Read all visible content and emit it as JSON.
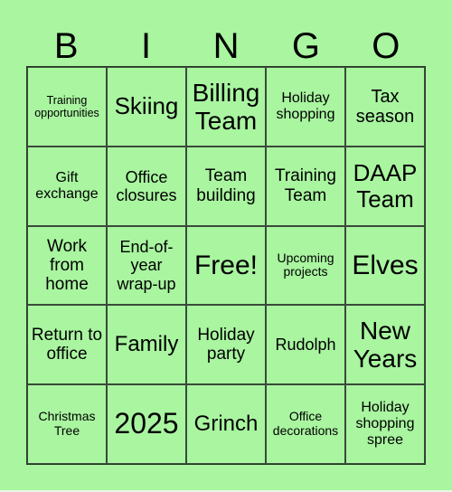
{
  "header": {
    "letters": [
      "B",
      "I",
      "N",
      "G",
      "O"
    ]
  },
  "cells": [
    {
      "text": "Training opportunities",
      "size": "s12"
    },
    {
      "text": "Skiing",
      "size": "s26"
    },
    {
      "text": "Billing Team",
      "size": "s28"
    },
    {
      "text": "Holiday shopping",
      "size": "s16"
    },
    {
      "text": "Tax season",
      "size": "s20"
    },
    {
      "text": "Gift exchange",
      "size": "s16"
    },
    {
      "text": "Office closures",
      "size": "s18"
    },
    {
      "text": "Team building",
      "size": "s19"
    },
    {
      "text": "Training Team",
      "size": "s19"
    },
    {
      "text": "DAAP Team",
      "size": "s26"
    },
    {
      "text": "Work from home",
      "size": "s19"
    },
    {
      "text": "End-of-year wrap-up",
      "size": "s18"
    },
    {
      "text": "Free!",
      "size": "s30"
    },
    {
      "text": "Upcoming projects",
      "size": "s14"
    },
    {
      "text": "Elves",
      "size": "s30"
    },
    {
      "text": "Return to office",
      "size": "s19"
    },
    {
      "text": "Family",
      "size": "s24"
    },
    {
      "text": "Holiday party",
      "size": "s19"
    },
    {
      "text": "Rudolph",
      "size": "s18"
    },
    {
      "text": "New Years",
      "size": "s28"
    },
    {
      "text": "Christmas Tree",
      "size": "s14"
    },
    {
      "text": "2025",
      "size": "s32"
    },
    {
      "text": "Grinch",
      "size": "s24"
    },
    {
      "text": "Office decorations",
      "size": "s14"
    },
    {
      "text": "Holiday shopping spree",
      "size": "s16"
    }
  ]
}
